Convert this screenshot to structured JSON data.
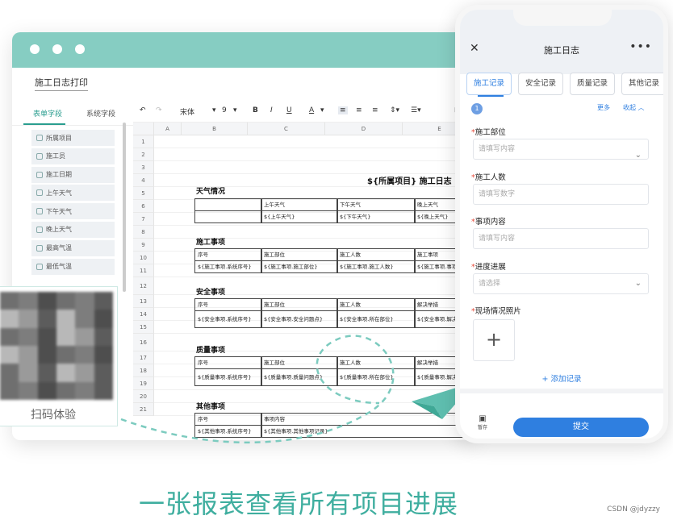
{
  "desktop": {
    "doc_title": "施工日志打印",
    "left_tabs": [
      "表单字段",
      "系统字段"
    ],
    "fields": [
      "所属项目",
      "施工员",
      "施工日期",
      "上午天气",
      "下午天气",
      "晚上天气",
      "最高气温",
      "最低气温"
    ],
    "toolbar": {
      "font": "宋体",
      "size": "9",
      "bold": "B",
      "italic": "I",
      "underline": "U",
      "color": "A"
    },
    "columns": [
      "A",
      "B",
      "C",
      "D",
      "E"
    ],
    "rows": [
      "1",
      "2",
      "3",
      "4",
      "5",
      "6",
      "7",
      "8",
      "9",
      "10",
      "11",
      "12",
      "13",
      "14",
      "15",
      "16",
      "17",
      "18",
      "19",
      "20",
      "21"
    ],
    "sheet_title": "${所属项目} 施工日志",
    "sections": {
      "weather": "天气情况",
      "construction": "施工事项",
      "safety": "安全事项",
      "quality": "质量事项",
      "other": "其他事项"
    },
    "weather_header": [
      "",
      "上午天气",
      "下午天气",
      "晚上天气"
    ],
    "weather_values": [
      "",
      "${上午天气}",
      "${下午天气}",
      "${晚上天气}"
    ],
    "construction_header": [
      "序号",
      "施工部位",
      "施工人数",
      "施工事项"
    ],
    "construction_values": [
      "${施工事项.系统序号}",
      "${施工事项.施工部位}",
      "${施工事项.施工人数}",
      "${施工事项.事项内"
    ],
    "safety_header": [
      "序号",
      "施工部位",
      "施工人数",
      "解决举措"
    ],
    "safety_values": [
      "${安全事项.系统序号}",
      "${安全事项.安全问题点}",
      "${安全事项.所在部位}",
      "${安全事项.解决举"
    ],
    "quality_header": [
      "序号",
      "施工部位",
      "施工人数",
      "解决举措"
    ],
    "quality_values": [
      "${质量事项.系统序号}",
      "${质量事项.质量问题点}",
      "${质量事项.所在部位}",
      "${质量事项.解决举"
    ],
    "other_header": [
      "序号",
      "事项内容"
    ],
    "other_values": [
      "${其他事项.系统序号}",
      "${其他事项.其他事项记录}"
    ]
  },
  "qr": {
    "caption": "扫码体验"
  },
  "phone": {
    "title": "施工日志",
    "tabs": [
      "施工记录",
      "安全记录",
      "质量记录",
      "其他记录"
    ],
    "record_number": "1",
    "more_label": "更多",
    "collapse_label": "收起",
    "fields": [
      {
        "label": "施工部位",
        "placeholder": "请填写内容"
      },
      {
        "label": "施工人数",
        "placeholder": "请填写数字"
      },
      {
        "label": "事项内容",
        "placeholder": "请填写内容"
      },
      {
        "label": "进度进展",
        "placeholder": "请选择"
      }
    ],
    "photo_label": "现场情况照片",
    "add_record": "添加记录",
    "save_label": "暂存",
    "submit_label": "提交"
  },
  "slogan": "一张报表查看所有项目进展",
  "watermark": "CSDN @jdyzzy",
  "colors": {
    "teal": "#86cdc2",
    "blue": "#2f7fe0",
    "slogan": "#3fae9f"
  }
}
